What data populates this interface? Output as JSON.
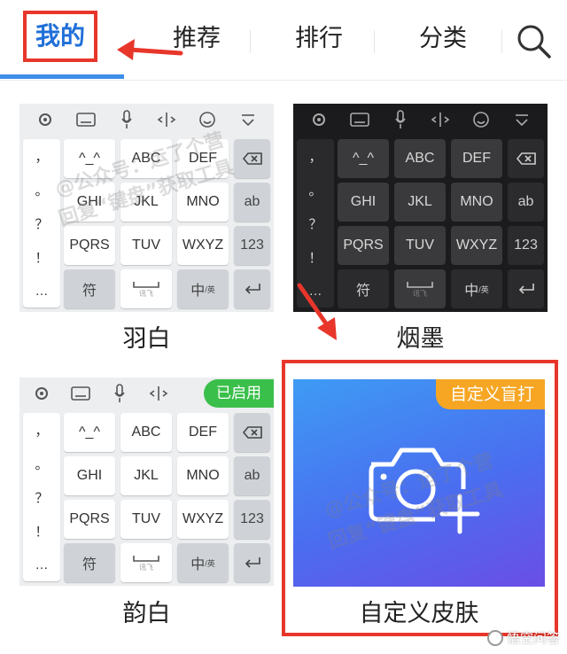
{
  "tabs": {
    "mine": "我的",
    "recommend": "推荐",
    "ranking": "排行",
    "category": "分类"
  },
  "keyboard_keys": {
    "side": [
      "，",
      "。",
      "？",
      "！",
      "…"
    ],
    "row1": [
      "^_^",
      "ABC",
      "DEF"
    ],
    "row2": [
      "GHI",
      "JKL",
      "MNO"
    ],
    "row3": [
      "PQRS",
      "TUV",
      "WXYZ"
    ],
    "ab": "ab",
    "num": "123",
    "symbol": "符",
    "chinese": "中",
    "chinese_sub": "/英",
    "space_brand": "讯飞"
  },
  "skins": {
    "yubai": {
      "name": "羽白"
    },
    "yanmo": {
      "name": "烟墨"
    },
    "yunbai": {
      "name": "韵白",
      "badge": "已启用"
    },
    "custom": {
      "name": "自定义皮肤",
      "badge": "自定义盲打"
    }
  },
  "watermark": {
    "line1": "@公众号：运了个营",
    "line2": "回复“键盘”获取工具"
  },
  "corner_logo": "悟空问答",
  "colors": {
    "accent_blue": "#1f6fd8",
    "highlight_red": "#e8362b",
    "badge_green": "#3bbf4b",
    "badge_orange": "#f6a623"
  }
}
